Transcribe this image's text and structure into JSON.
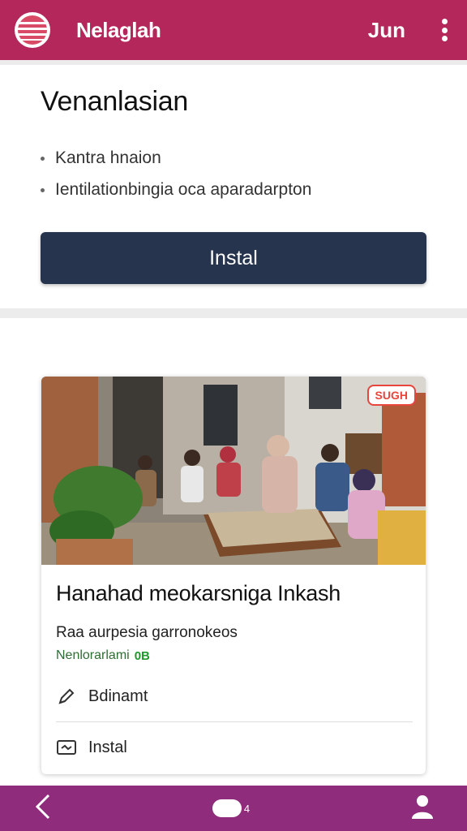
{
  "appbar": {
    "title": "Nelaglah",
    "link_label": "Jun",
    "logo_icon": "globe-icon",
    "menu_icon": "kebab-menu-icon",
    "background": "#b3275a"
  },
  "info_card": {
    "title": "Venanlasian",
    "bullets": [
      "Kantra hnaion",
      "Ientilationbingia oca aparadarpton"
    ],
    "button_label": "Instal",
    "button_color": "#26344d"
  },
  "post": {
    "badge": "SUGH",
    "title": "Hanahad meokarsniga Inkash",
    "subtitle": "Raa aurpesia garronokeos",
    "meta_text": "Nenlorarlami",
    "meta_badge": "0B",
    "actions": [
      {
        "icon": "pencil-icon",
        "label": "Bdinamt"
      },
      {
        "icon": "message-icon",
        "label": "Instal"
      }
    ]
  },
  "bottom_nav": {
    "back_icon": "back-chevron-icon",
    "center_icon": "pill-icon",
    "center_count": "4",
    "profile_icon": "person-icon",
    "background": "#8f2d7c"
  }
}
